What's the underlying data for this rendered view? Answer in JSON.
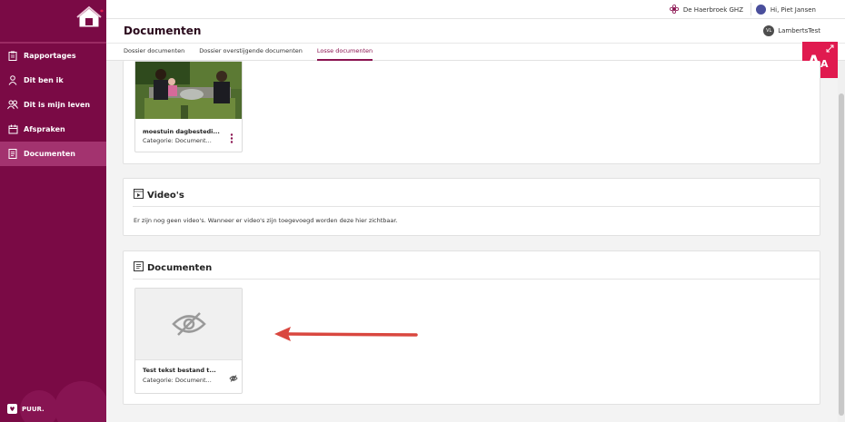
{
  "sidebar": {
    "items": [
      {
        "label": "Rapportages",
        "icon": "clipboard-icon"
      },
      {
        "label": "Dit ben ik",
        "icon": "person-icon"
      },
      {
        "label": "Dit is mijn leven",
        "icon": "people-icon"
      },
      {
        "label": "Afspraken",
        "icon": "calendar-icon"
      },
      {
        "label": "Documenten",
        "icon": "document-icon",
        "active": true
      }
    ],
    "footer_label": "PUUR."
  },
  "topbar": {
    "organization": "De Haerbroek GHZ",
    "user_greeting": "Hi, Piet Jansen"
  },
  "header": {
    "title": "Documenten",
    "client_initials": "VL",
    "client_name": "LambertsTest",
    "tabs": [
      {
        "label": "Dossier documenten"
      },
      {
        "label": "Dossier overstijgende documenten"
      },
      {
        "label": "Losse documenten",
        "active": true
      }
    ]
  },
  "accessibility": {
    "big": "A",
    "small": "A"
  },
  "photos": {
    "item": {
      "name": "moestuin dagbestedi...",
      "category": "Categorie: Document..."
    }
  },
  "videos": {
    "title": "Video's",
    "empty_message": "Er zijn nog geen video's. Wanneer er video's zijn toegevoegd worden deze hier zichtbaar."
  },
  "documents": {
    "title": "Documenten",
    "item": {
      "name": "Test tekst bestand t...",
      "category": "Categorie: Document..."
    }
  },
  "colors": {
    "brand": "#7a0a45",
    "accent": "#e01a4f",
    "active_tab": "#8a1350"
  }
}
